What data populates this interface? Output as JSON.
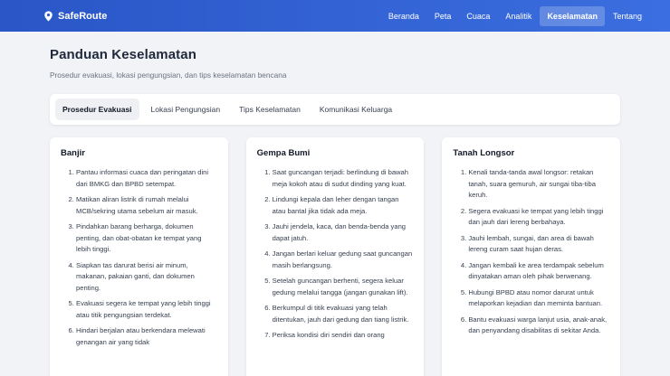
{
  "nav": {
    "brand": "SafeRoute",
    "links": [
      "Beranda",
      "Peta",
      "Cuaca",
      "Analitik",
      "Keselamatan",
      "Tentang"
    ]
  },
  "page": {
    "title": "Panduan Keselamatan",
    "subtitle": "Prosedur evakuasi, lokasi pengungsian, dan tips keselamatan bencana"
  },
  "tabs": [
    "Prosedur Evakuasi",
    "Lokasi Pengungsian",
    "Tips Keselamatan",
    "Komunikasi Keluarga"
  ],
  "cards": [
    {
      "title": "Banjir",
      "items": [
        "Pantau informasi cuaca dan peringatan dini dari BMKG dan BPBD setempat.",
        "Matikan aliran listrik di rumah melalui MCB/sekring utama sebelum air masuk.",
        "Pindahkan barang berharga, dokumen penting, dan obat-obatan ke tempat yang lebih tinggi.",
        "Siapkan tas darurat berisi air minum, makanan, pakaian ganti, dan dokumen penting.",
        "Evakuasi segera ke tempat yang lebih tinggi atau titik pengungsian terdekat.",
        "Hindari berjalan atau berkendara melewati genangan air yang tidak"
      ]
    },
    {
      "title": "Gempa Bumi",
      "items": [
        "Saat guncangan terjadi: berlindung di bawah meja kokoh atau di sudut dinding yang kuat.",
        "Lindungi kepala dan leher dengan tangan atau bantal jika tidak ada meja.",
        "Jauhi jendela, kaca, dan benda-benda yang dapat jatuh.",
        "Jangan berlari keluar gedung saat guncangan masih berlangsung.",
        "Setelah guncangan berhenti, segera keluar gedung melalui tangga (jangan gunakan lift).",
        "Berkumpul di titik evakuasi yang telah ditentukan, jauh dari gedung dan tiang listrik.",
        "Periksa kondisi diri sendiri dan orang"
      ]
    },
    {
      "title": "Tanah Longsor",
      "items": [
        "Kenali tanda-tanda awal longsor: retakan tanah, suara gemuruh, air sungai tiba-tiba keruh.",
        "Segera evakuasi ke tempat yang lebih tinggi dan jauh dari lereng berbahaya.",
        "Jauhi lembah, sungai, dan area di bawah lereng curam saat hujan deras.",
        "Jangan kembali ke area terdampak sebelum dinyatakan aman oleh pihak berwenang.",
        "Hubungi BPBD atau nomor darurat untuk melaporkan kejadian dan meminta bantuan.",
        "Bantu evakuasi warga lanjut usia, anak-anak, dan penyandang disabilitas di sekitar Anda."
      ]
    }
  ]
}
